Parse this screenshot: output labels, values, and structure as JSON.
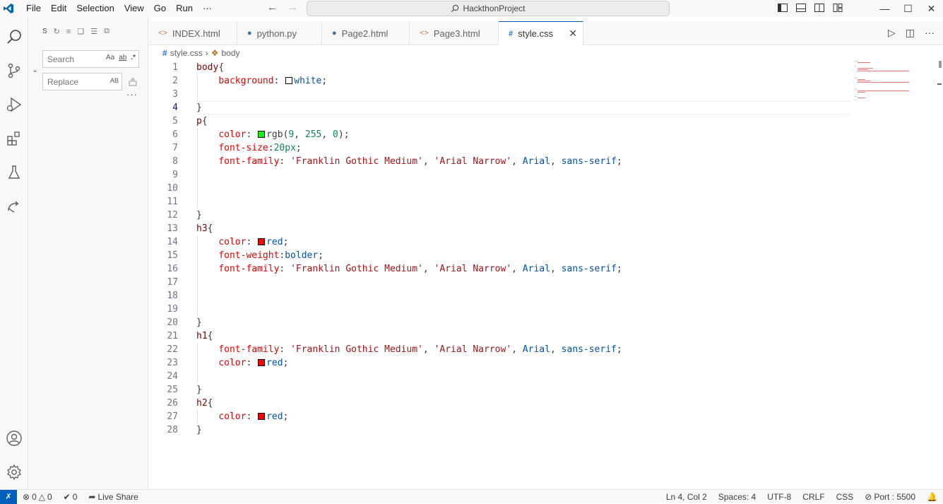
{
  "titlebar": {
    "menu": [
      "File",
      "Edit",
      "Selection",
      "View",
      "Go",
      "Run",
      "···"
    ],
    "command_center": "HackthonProject",
    "logo_color": "#0065a9"
  },
  "sidebar": {
    "section_label": "S",
    "search_placeholder": "Search",
    "search_options": [
      "Aa",
      "ab",
      ".*"
    ],
    "replace_placeholder": "Replace",
    "replace_option": "AB",
    "more": "···"
  },
  "tabs": [
    {
      "label": "INDEX.html",
      "icon": "<>",
      "active": false
    },
    {
      "label": "python.py",
      "icon": "py",
      "active": false
    },
    {
      "label": "Page2.html",
      "icon": "<>",
      "active": false
    },
    {
      "label": "Page3.html",
      "icon": "<>",
      "active": false
    },
    {
      "label": "style.css",
      "icon": "#",
      "active": true
    }
  ],
  "breadcrumb": {
    "file": "style.css",
    "symbol": "body"
  },
  "editor": {
    "current_line": 4,
    "lines": [
      "body{",
      "    background: white;",
      "",
      "}",
      "p{",
      "    color: rgb(9, 255, 0);",
      "    font-size:20px;",
      "    font-family: 'Franklin Gothic Medium', 'Arial Narrow', Arial, sans-serif;",
      "",
      "",
      "",
      "}",
      "h3{",
      "    color: red;",
      "    font-weight:bolder;",
      "    font-family: 'Franklin Gothic Medium', 'Arial Narrow', Arial, sans-serif;",
      "",
      "",
      "",
      "}",
      "h1{",
      "    font-family: 'Franklin Gothic Medium', 'Arial Narrow', Arial, sans-serif;",
      "    color: red;",
      "",
      "}",
      "h2{",
      "    color: red;",
      "}"
    ],
    "swatches": {
      "white": "#ffffff",
      "green": "#09ff00",
      "red": "#ff0000"
    }
  },
  "statusbar": {
    "errors": "0",
    "warnings": "0",
    "ports": "0",
    "live_share": "Live Share",
    "position": "Ln 4, Col 2",
    "spaces": "Spaces: 4",
    "encoding": "UTF-8",
    "eol": "CRLF",
    "language": "CSS",
    "port": "Port : 5500",
    "accent": "#005fb8"
  }
}
